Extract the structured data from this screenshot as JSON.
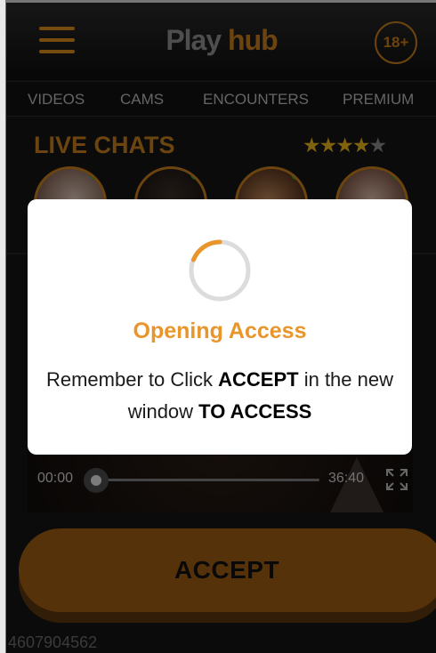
{
  "header": {
    "logo_part1": "Play",
    "logo_part2": " hub",
    "age_badge": "18+",
    "menu_icon": "hamburger-menu-icon"
  },
  "nav": {
    "items": [
      {
        "label": "VIDEOS"
      },
      {
        "label": "CAMS"
      },
      {
        "label": "ENCOUNTERS"
      },
      {
        "label": "PREMIUM"
      }
    ]
  },
  "live": {
    "title": "LIVE CHATS",
    "rating": 4.5,
    "rating_max": 5,
    "avatars": [
      {
        "status": "online"
      },
      {
        "status": "online"
      },
      {
        "status": "online"
      },
      {
        "status": "online"
      }
    ]
  },
  "player": {
    "current_time": "00:00",
    "duration": "36:40",
    "progress": 0,
    "fullscreen_icon": "fullscreen-icon"
  },
  "cta": {
    "label": "ACCEPT"
  },
  "footer": {
    "id_text": "4607904562"
  },
  "modal": {
    "title": "Opening Access",
    "message_part1": "Remember to Click ",
    "message_bold1": "ACCEPT",
    "message_part2": " in the new window ",
    "message_bold2": "TO ACCESS"
  },
  "colors": {
    "accent": "#c47d1c",
    "button": "#9b5c12",
    "modal_title": "#e8952c",
    "online": "#1db91d",
    "star": "#e8b21a"
  }
}
